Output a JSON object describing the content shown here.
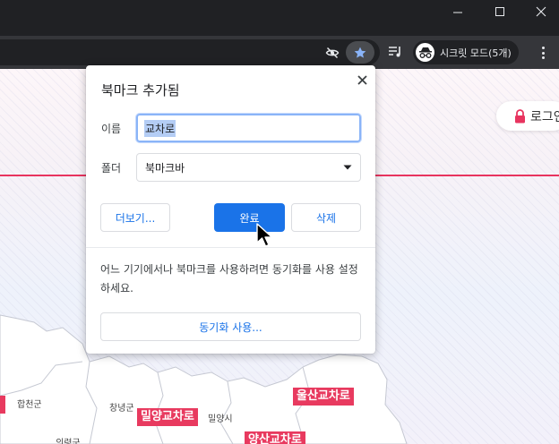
{
  "browser": {
    "incognito_label": "시크릿 모드(5개)"
  },
  "page": {
    "login_label": "로그인",
    "map_regions": [
      "합천군",
      "창녕군",
      "밀양시",
      "의령군"
    ],
    "interchanges": [
      "밀양교차로",
      "울산교차로",
      "양산교차로"
    ]
  },
  "dialog": {
    "title": "북마크 추가됨",
    "name_label": "이름",
    "name_value": "교차로",
    "folder_label": "폴더",
    "folder_value": "북마크바",
    "more_button": "더보기...",
    "done_button": "완료",
    "remove_button": "삭제",
    "sync_message": "어느 기기에서나 북마크를 사용하려면 동기화를 사용 설정하세요.",
    "sync_button": "동기화 사용..."
  },
  "colors": {
    "chrome_dark": "#202124",
    "toolbar": "#35363a",
    "accent_blue": "#1a73e8",
    "brand_red": "#e8345f"
  },
  "icons": [
    "minimize-icon",
    "maximize-icon",
    "close-window-icon",
    "eye-off-icon",
    "star-icon",
    "reading-list-icon",
    "incognito-icon",
    "more-vert-icon",
    "lock-icon",
    "close-icon",
    "dropdown-arrow-icon",
    "cursor-icon"
  ]
}
